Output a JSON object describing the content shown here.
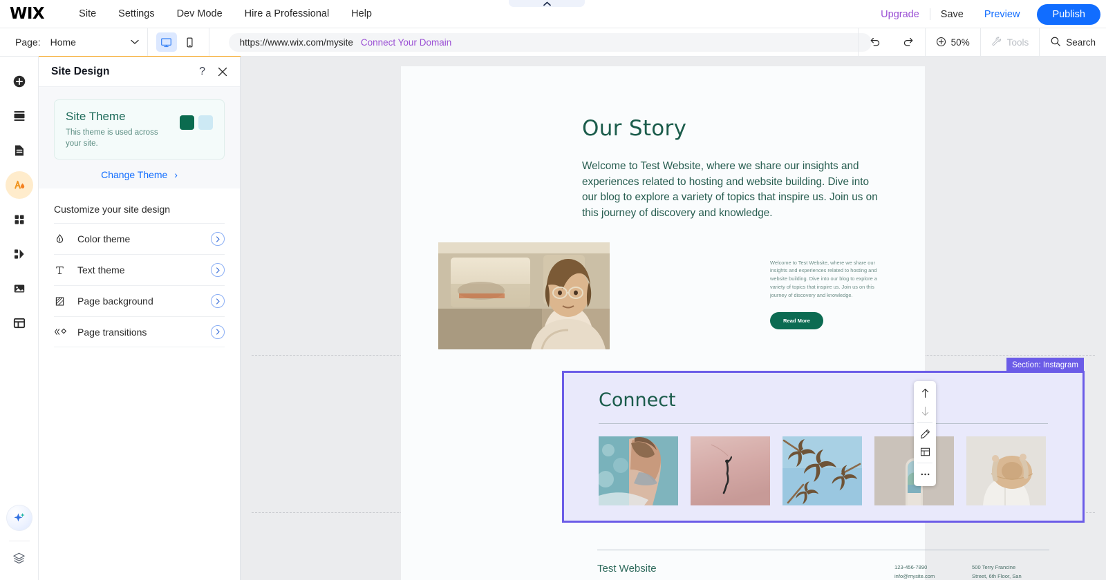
{
  "topbar": {
    "logo": "WIX",
    "menu": [
      {
        "label": "Site"
      },
      {
        "label": "Settings"
      },
      {
        "label": "Dev Mode"
      },
      {
        "label": "Hire a Professional"
      },
      {
        "label": "Help"
      }
    ],
    "upgrade": "Upgrade",
    "save": "Save",
    "preview": "Preview",
    "publish": "Publish",
    "collapse_icon": "chevron-up-icon"
  },
  "subbar": {
    "page_label": "Page:",
    "page_value": "Home",
    "page_chevron": "chevron-down-icon",
    "desktop_icon": "desktop-icon",
    "mobile_icon": "mobile-icon",
    "url": "https://www.wix.com/mysite",
    "connect_domain": "Connect Your Domain",
    "undo_icon": "undo-icon",
    "redo_icon": "redo-icon",
    "zoom_icon": "zoom-icon",
    "zoom_value": "50%",
    "tools_icon": "wrench-icon",
    "tools_label": "Tools",
    "search_icon": "search-icon",
    "search_label": "Search"
  },
  "rail": {
    "items": [
      {
        "name": "add-elements-icon"
      },
      {
        "name": "sections-icon"
      },
      {
        "name": "pages-icon"
      },
      {
        "name": "site-design-icon",
        "selected": true
      },
      {
        "name": "apps-icon"
      },
      {
        "name": "integrations-icon"
      },
      {
        "name": "media-icon"
      },
      {
        "name": "cms-icon"
      }
    ],
    "ai_icon": "ai-sparkle-icon",
    "layers_icon": "layers-icon"
  },
  "panel": {
    "title": "Site Design",
    "help_icon": "question-mark-icon",
    "close_icon": "close-icon",
    "theme": {
      "name": "Site Theme",
      "description": "This theme is used across your site.",
      "swatch_primary": "#0b6b4f",
      "swatch_secondary": "#cde9f4",
      "change_theme": "Change Theme",
      "change_theme_arrow": "chevron-right-icon"
    },
    "customize_title": "Customize your site design",
    "options": [
      {
        "label": "Color theme",
        "icon": "color-drop-icon"
      },
      {
        "label": "Text theme",
        "icon": "text-t-icon"
      },
      {
        "label": "Page background",
        "icon": "page-background-icon"
      },
      {
        "label": "Page transitions",
        "icon": "page-transitions-icon"
      }
    ]
  },
  "canvas": {
    "story": {
      "heading": "Our Story",
      "paragraph": "Welcome to Test Website, where we share our insights and experiences related to hosting and website building. Dive into our blog to explore a variety of topics that inspire us. Join us on this journey of discovery and knowledge.",
      "image_alt": "person-in-car-photo",
      "side_paragraph": "Welcome to Test Website, where we share our insights and experiences related to hosting and website building. Dive into our blog to explore a variety of topics that inspire us. Join us on this journey of discovery and knowledge.",
      "button": "Read More"
    },
    "connect": {
      "section_tag": "Section: Instagram",
      "heading": "Connect",
      "gallery": [
        {
          "alt": "woman-in-pool-photo"
        },
        {
          "alt": "pink-water-swimmer-photo"
        },
        {
          "alt": "palm-trees-sky-photo"
        },
        {
          "alt": "arched-doorway-photo"
        },
        {
          "alt": "woman-with-sun-hat-photo"
        }
      ]
    },
    "footer": {
      "brand": "Test Website",
      "contact_line1": "123-456-7890",
      "contact_line2": "info@mysite.com",
      "address_line1": "500 Terry Francine",
      "address_line2": "Street, 6th Floor, San"
    },
    "float_tools": [
      {
        "name": "move-up-icon"
      },
      {
        "name": "move-down-icon"
      },
      {
        "name": "edit-pencil-icon"
      },
      {
        "name": "layout-icon"
      },
      {
        "name": "more-options-icon"
      }
    ]
  }
}
